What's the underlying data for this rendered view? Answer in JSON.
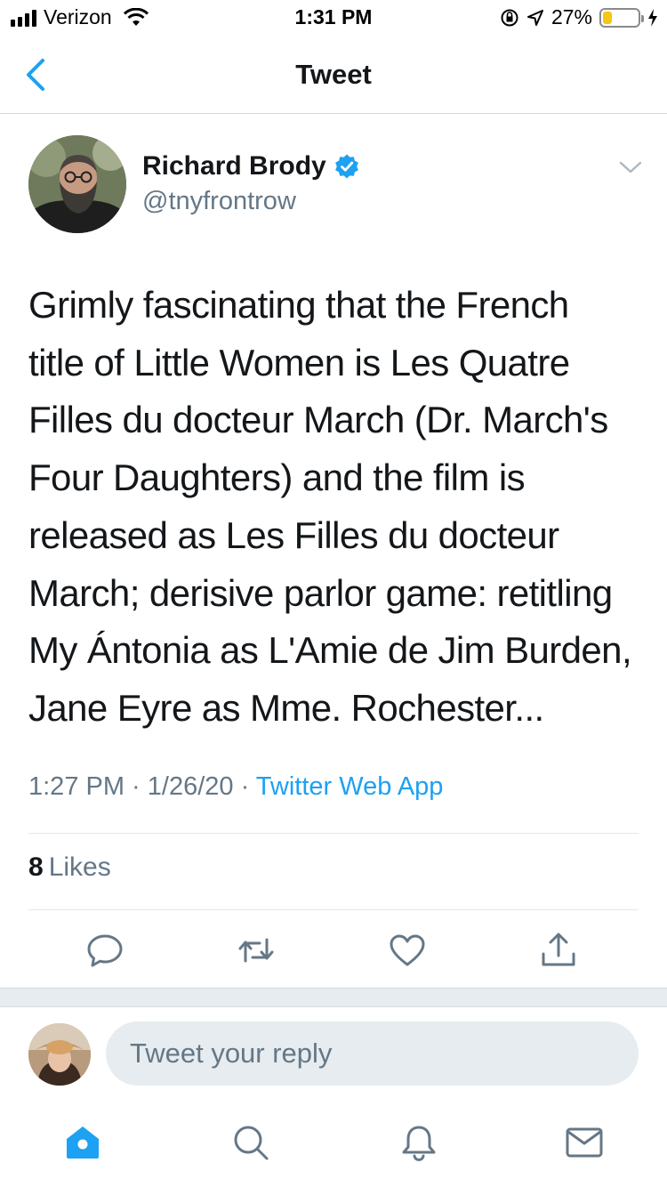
{
  "status_bar": {
    "carrier": "Verizon",
    "time": "1:31 PM",
    "battery_percent": "27%",
    "battery_level": 0.27
  },
  "nav": {
    "back_icon": "chevron-left-icon",
    "title": "Tweet"
  },
  "tweet": {
    "author_name": "Richard Brody",
    "author_handle": "@tnyfrontrow",
    "verified": true,
    "text": "Grimly fascinating that the French\ntitle of Little Women is Les Quatre\nFilles du docteur March (Dr. March's\nFour Daughters) and the film is\nreleased as Les Filles du docteur\nMarch; derisive parlor game: retitling\nMy Ántonia as L'Amie de Jim Burden,\nJane Eyre as Mme. Rochester...",
    "time": "1:27 PM",
    "date": "1/26/20",
    "separator": " · ",
    "source": "Twitter Web App",
    "likes_count": "8",
    "likes_label": "Likes"
  },
  "actions": [
    "reply-icon",
    "retweet-icon",
    "like-icon",
    "share-icon"
  ],
  "reply": {
    "placeholder": "Tweet your reply"
  },
  "tab_bar": [
    "home-icon",
    "search-icon",
    "notifications-icon",
    "messages-icon"
  ],
  "colors": {
    "accent": "#1da1f2",
    "secondary_text": "#657786",
    "icon_gray": "#657786",
    "divider": "#e1e8ed",
    "input_bg": "#e6ecf0",
    "battery": "#f5c518"
  }
}
